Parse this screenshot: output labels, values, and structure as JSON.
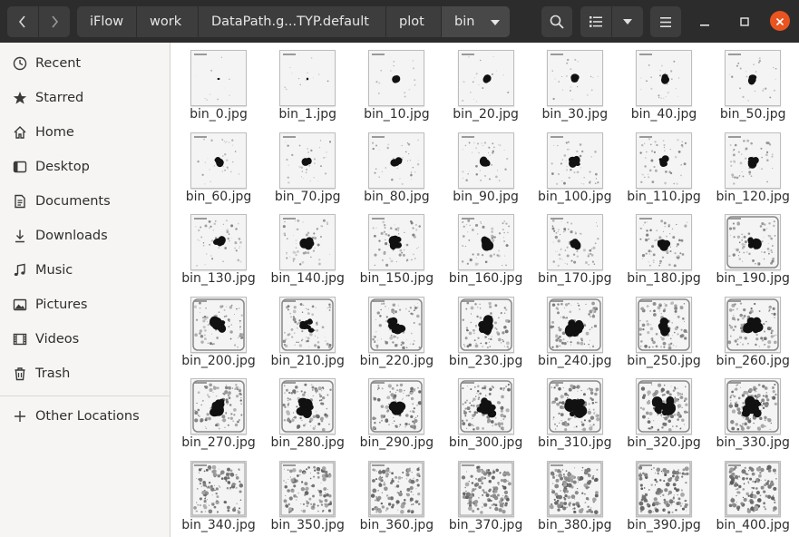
{
  "header": {
    "back_icon": "chevron-left-icon",
    "forward_icon": "chevron-right-icon",
    "breadcrumbs": [
      "iFlow",
      "work",
      "DataPath.g...TYP.default",
      "plot",
      "bin"
    ],
    "search_icon": "search-icon",
    "view_icon": "list-view-icon",
    "view_options_icon": "chevron-down-icon",
    "menu_icon": "hamburger-menu-icon",
    "accent_close": "#e95420"
  },
  "sidebar": {
    "items": [
      {
        "label": "Recent",
        "icon": "clock-icon"
      },
      {
        "label": "Starred",
        "icon": "star-icon"
      },
      {
        "label": "Home",
        "icon": "home-icon"
      },
      {
        "label": "Desktop",
        "icon": "desktop-icon"
      },
      {
        "label": "Documents",
        "icon": "documents-icon"
      },
      {
        "label": "Downloads",
        "icon": "downloads-icon"
      },
      {
        "label": "Music",
        "icon": "music-icon"
      },
      {
        "label": "Pictures",
        "icon": "pictures-icon"
      },
      {
        "label": "Videos",
        "icon": "videos-icon"
      },
      {
        "label": "Trash",
        "icon": "trash-icon"
      }
    ],
    "other": {
      "label": "Other Locations",
      "icon": "plus-icon"
    }
  },
  "files": [
    "bin_0.jpg",
    "bin_1.jpg",
    "bin_10.jpg",
    "bin_20.jpg",
    "bin_30.jpg",
    "bin_40.jpg",
    "bin_50.jpg",
    "bin_60.jpg",
    "bin_70.jpg",
    "bin_80.jpg",
    "bin_90.jpg",
    "bin_100.jpg",
    "bin_110.jpg",
    "bin_120.jpg",
    "bin_130.jpg",
    "bin_140.jpg",
    "bin_150.jpg",
    "bin_160.jpg",
    "bin_170.jpg",
    "bin_180.jpg",
    "bin_190.jpg",
    "bin_200.jpg",
    "bin_210.jpg",
    "bin_220.jpg",
    "bin_230.jpg",
    "bin_240.jpg",
    "bin_250.jpg",
    "bin_260.jpg",
    "bin_270.jpg",
    "bin_280.jpg",
    "bin_290.jpg",
    "bin_300.jpg",
    "bin_310.jpg",
    "bin_320.jpg",
    "bin_330.jpg",
    "bin_340.jpg",
    "bin_350.jpg",
    "bin_360.jpg",
    "bin_370.jpg",
    "bin_380.jpg",
    "bin_390.jpg",
    "bin_400.jpg"
  ]
}
